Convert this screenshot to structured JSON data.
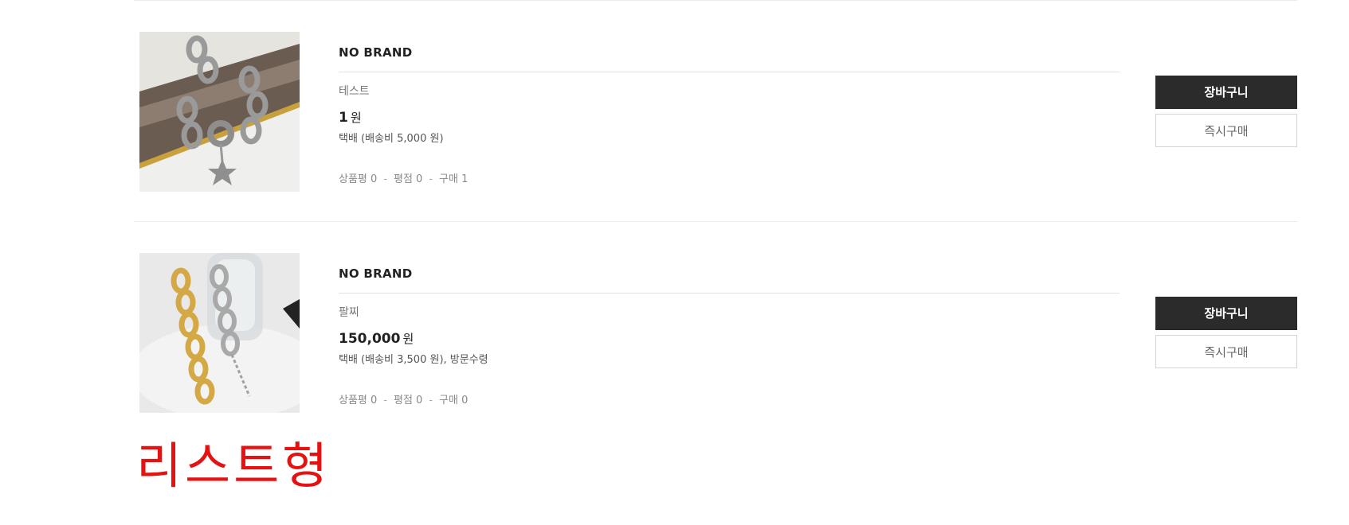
{
  "products": [
    {
      "brand": "NO BRAND",
      "name": "테스트",
      "price": "1",
      "currency": "원",
      "shipping": "택배 (배송비 5,000 원)",
      "reviews_label": "상품평 0",
      "rating_label": "평점 0",
      "purchases_label": "구매 1",
      "image": "silver-star-bracelet-photo",
      "cart_button": "장바구니",
      "buy_button": "즉시구매"
    },
    {
      "brand": "NO BRAND",
      "name": "팔찌",
      "price": "150,000",
      "currency": "원",
      "shipping": "택배 (배송비 3,500 원), 방문수령",
      "reviews_label": "상품평 0",
      "rating_label": "평점 0",
      "purchases_label": "구매 0",
      "image": "gold-silver-chain-bracelets-photo",
      "cart_button": "장바구니",
      "buy_button": "즉시구매"
    }
  ],
  "caption": "리스트형",
  "colors": {
    "cart_button_bg": "#2b2b2b",
    "caption": "#e61212",
    "divider": "#ebebeb"
  }
}
